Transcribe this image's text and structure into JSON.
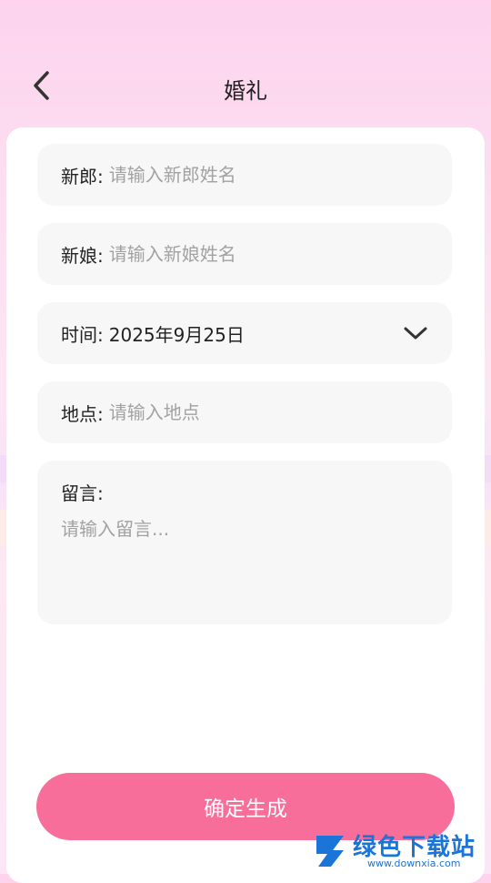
{
  "header": {
    "title": "婚礼",
    "back_icon": "chevron-left-icon"
  },
  "form": {
    "groom": {
      "label": "新郎:",
      "placeholder": "请输入新郎姓名",
      "value": ""
    },
    "bride": {
      "label": "新娘:",
      "placeholder": "请输入新娘姓名",
      "value": ""
    },
    "time": {
      "label": "时间:",
      "value": "2025年9月25日",
      "dropdown_icon": "chevron-down-icon"
    },
    "place": {
      "label": "地点:",
      "placeholder": "请输入地点",
      "value": ""
    },
    "message": {
      "label": "留言:",
      "placeholder": "请输入留言...",
      "value": ""
    }
  },
  "submit": {
    "label": "确定生成"
  },
  "watermark": {
    "text": "绿色下载站",
    "url": "www.downxia.com"
  },
  "colors": {
    "accent": "#f76e9b",
    "field_bg": "#f7f7f7",
    "placeholder": "#a2a2a2"
  }
}
